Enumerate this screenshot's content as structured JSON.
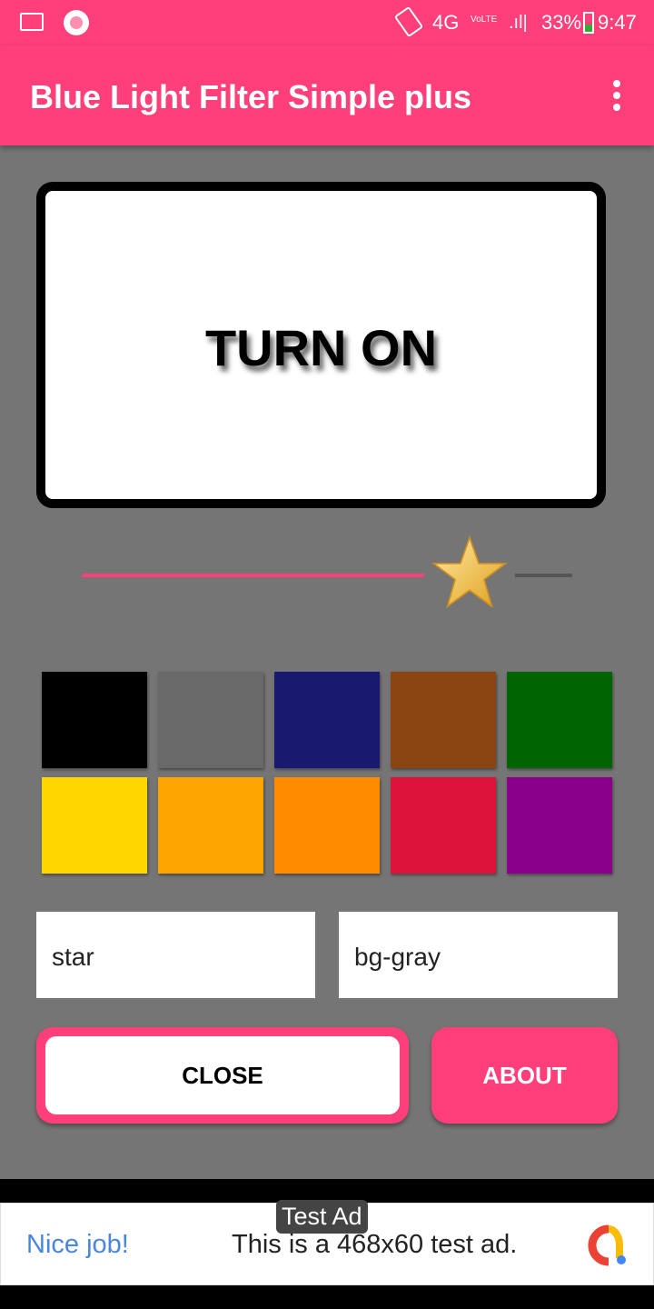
{
  "status_bar": {
    "time": "9:47",
    "battery": "33%",
    "network": "4G",
    "volte": "VoLTE",
    "icons": [
      "image-icon",
      "record-icon",
      "rotate-icon",
      "signal-icon",
      "battery-icon"
    ]
  },
  "app_bar": {
    "title": "Blue Light Filter Simple plus",
    "menu_icon": "more-vert-icon"
  },
  "toggle_button": {
    "label": "TURN ON"
  },
  "slider": {
    "value_percent": 79,
    "active_color": "#fe3f7a",
    "thumb_icon": "star-icon"
  },
  "colors": [
    "#000000",
    "#696969",
    "#191970",
    "#8b4513",
    "#006400",
    "#ffd700",
    "#ffa500",
    "#ff8c00",
    "#dc143c",
    "#8b008b"
  ],
  "fields": {
    "left": "star",
    "right": "bg-gray"
  },
  "buttons": {
    "close": "CLOSE",
    "about": "ABOUT"
  },
  "ad": {
    "badge": "Test Ad",
    "headline": "Nice job!",
    "text": "This is a 468x60 test ad."
  }
}
